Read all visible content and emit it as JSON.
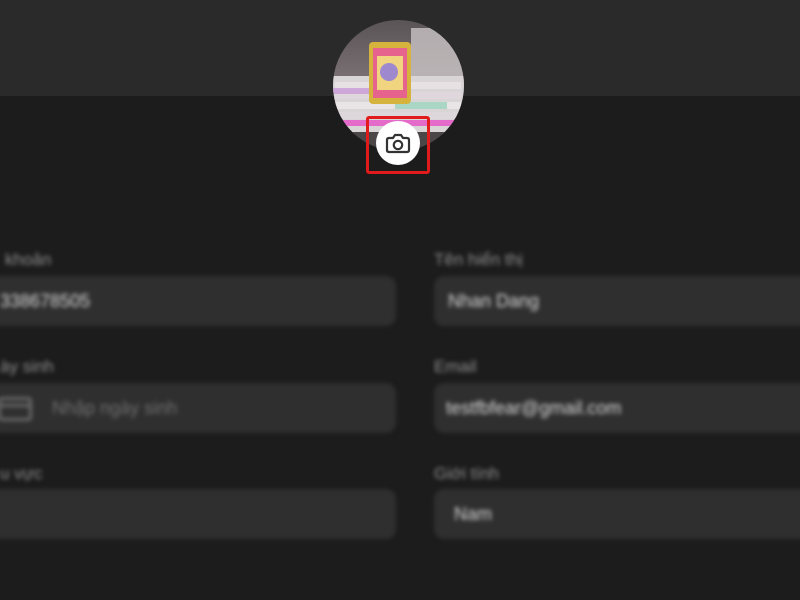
{
  "profile": {
    "avatar_alt": "Profile photo"
  },
  "form": {
    "account": {
      "label": "khoản",
      "value": "338678505"
    },
    "display_name": {
      "label": "Tên hiển thị",
      "value": "Nhan Dang"
    },
    "birthday": {
      "label": "ày sinh",
      "placeholder": "Nhập ngày sinh"
    },
    "email": {
      "label": "Email",
      "value": "testfbfear@gmail.com"
    },
    "role": {
      "label": "u vực",
      "value": ""
    },
    "gender": {
      "label": "Giới tính",
      "value": "Nam"
    }
  },
  "colors": {
    "background": "#1c1c1c",
    "top_band": "#2a2a2a",
    "field": "#2f2f2f",
    "highlight": "#e11b1b",
    "camera_button": "#ffffff"
  },
  "icons": {
    "camera": "camera-icon",
    "calendar": "calendar-icon"
  }
}
